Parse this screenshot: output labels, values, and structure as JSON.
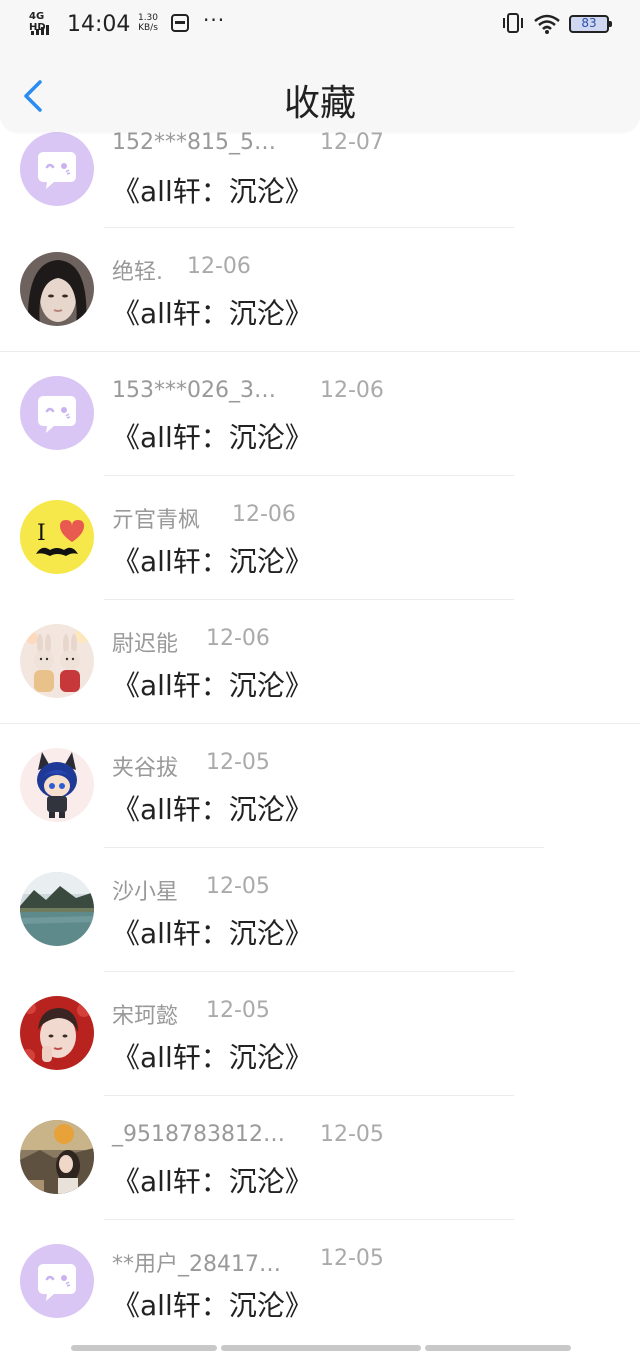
{
  "status_bar": {
    "network": "4G HD",
    "time": "14:04",
    "speed_value": "1.30",
    "speed_unit": "KB/s",
    "more": "···",
    "battery": "83"
  },
  "header": {
    "title": "收藏",
    "back_icon": "chevron-left-icon"
  },
  "items": [
    {
      "name": "152***815_5…",
      "date": "12-07",
      "content": "《all轩：沉沦》",
      "avatar": "chat-bubble-default"
    },
    {
      "name": "绝轻.",
      "date": "12-06",
      "content": "《all轩：沉沦》",
      "avatar": "photo-girl-dark-hair"
    },
    {
      "name": "153***026_3…",
      "date": "12-06",
      "content": "《all轩：沉沦》",
      "avatar": "chat-bubble-default"
    },
    {
      "name": "亓官青枫",
      "date": "12-06",
      "content": "《all轩：沉沦》",
      "avatar": "i-love-mustache"
    },
    {
      "name": "尉迟能",
      "date": "12-06",
      "content": "《all轩：沉沦》",
      "avatar": "bunny-dolls"
    },
    {
      "name": "夹谷拔",
      "date": "12-05",
      "content": "《all轩：沉沦》",
      "avatar": "anime-cat-boy"
    },
    {
      "name": "沙小星",
      "date": "12-05",
      "content": "《all轩：沉沦》",
      "avatar": "lake-mountain"
    },
    {
      "name": "宋珂懿",
      "date": "12-05",
      "content": "《all轩：沉沦》",
      "avatar": "photo-girl-red"
    },
    {
      "name": "_9518783812…",
      "date": "12-05",
      "content": "《all轩：沉沦》",
      "avatar": "photo-autumn-girl"
    },
    {
      "name": "**用户_28417…",
      "date": "12-05",
      "content": "《all轩：沉沦》",
      "avatar": "chat-bubble-default"
    }
  ],
  "colors": {
    "accent": "#2a8bf2",
    "default_avatar_bg": "#d9c6f5",
    "name_text": "#999999",
    "content_text": "#222222"
  }
}
